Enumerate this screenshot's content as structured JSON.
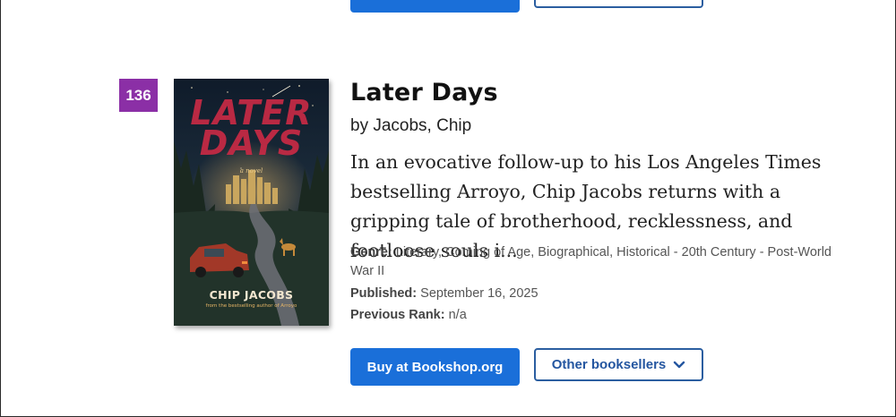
{
  "entry": {
    "rank": "136",
    "title": "Later Days",
    "author_line": "by Jacobs, Chip",
    "description": "In an evocative follow-up to his Los Angeles Times bestselling Arroyo, Chip Jacobs returns with a gripping tale of brotherhood, recklessness, and footloose souls i...",
    "genre_label": "Genre:",
    "genre_value": "Literary, Coming of Age, Biographical, Historical - 20th Century - Post-World War II",
    "published_label": "Published:",
    "published_value": "September 16, 2025",
    "previous_rank_label": "Previous Rank:",
    "previous_rank_value": "n/a",
    "cover": {
      "title_line1": "LATER",
      "title_line2": "DAYS",
      "subtitle": "a novel",
      "author": "CHIP JACOBS",
      "tagline": "from the bestselling author of Arroyo"
    }
  },
  "buttons": {
    "buy_label": "Buy at Bookshop.org",
    "other_label": "Other booksellers",
    "other_icon": "chevron-down-icon"
  },
  "colors": {
    "rank_badge": "#8b2fa6",
    "buy_button": "#1a6fd9",
    "other_button_border": "#2b5ea0"
  }
}
